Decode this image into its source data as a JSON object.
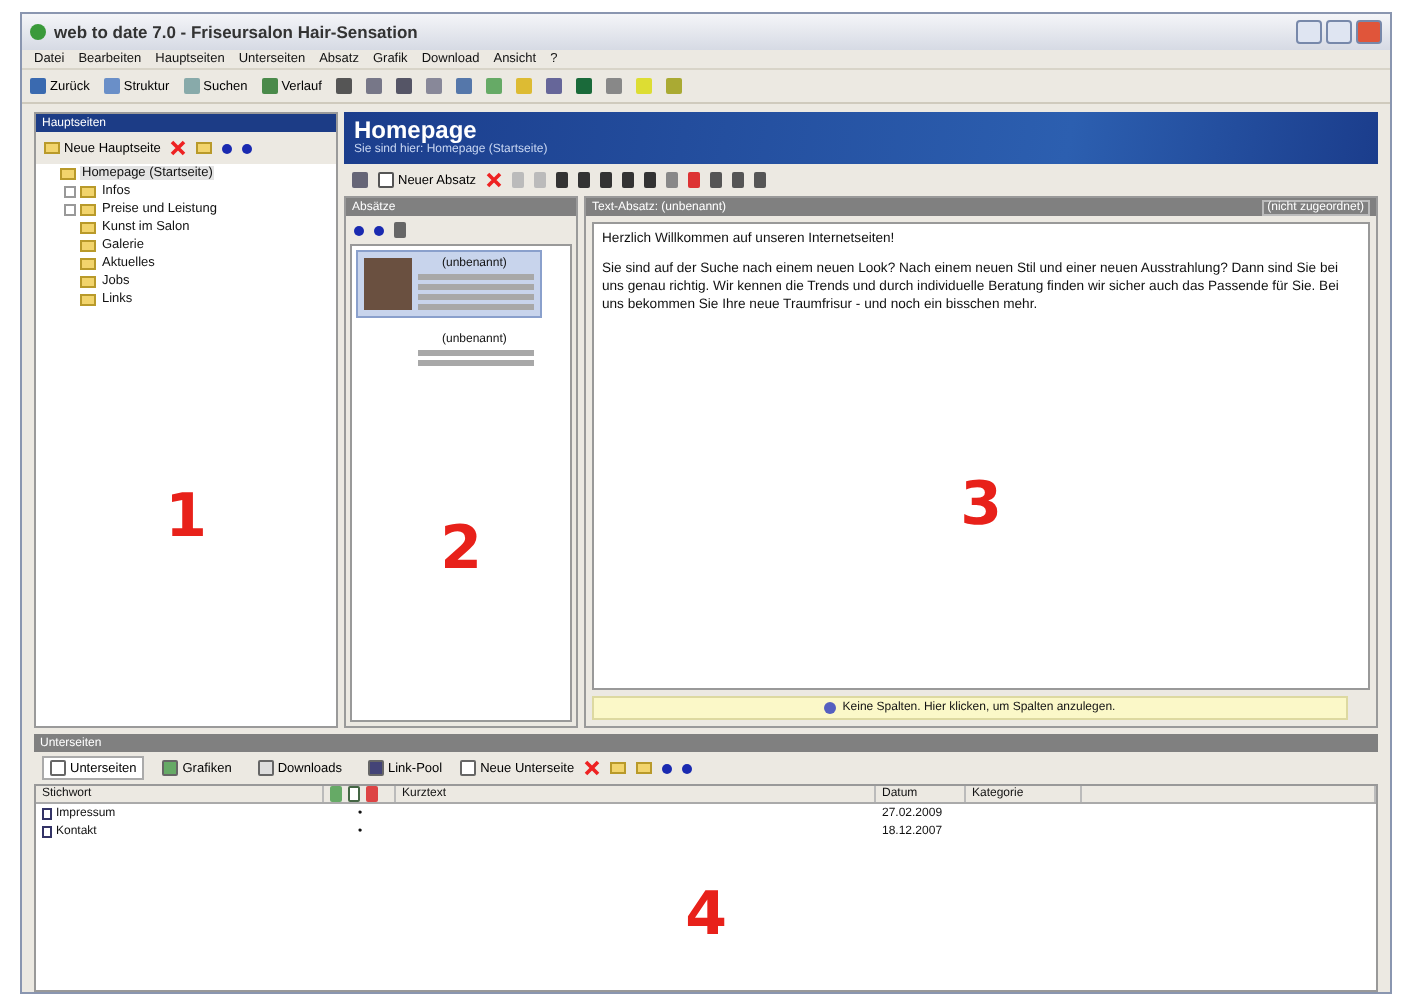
{
  "window": {
    "title": "web to date 7.0 - Friseursalon Hair-Sensation"
  },
  "menu": [
    "Datei",
    "Bearbeiten",
    "Hauptseiten",
    "Unterseiten",
    "Absatz",
    "Grafik",
    "Download",
    "Ansicht",
    "?"
  ],
  "toolbar": [
    {
      "label": "Zurück",
      "kind": "back"
    },
    {
      "label": "Struktur",
      "kind": "structure"
    },
    {
      "label": "Suchen",
      "kind": "search"
    },
    {
      "label": "Verlauf",
      "kind": "history"
    }
  ],
  "main_pages": {
    "header": "Hauptseiten",
    "new_button": "Neue Hauptseite",
    "tree": [
      {
        "label": "Homepage (Startseite)",
        "collapsed": false,
        "selected": true,
        "children": [
          {
            "label": "Infos",
            "collapsed": true,
            "selected": false
          },
          {
            "label": "Preise und Leistung",
            "collapsed": true,
            "selected": false
          },
          {
            "label": "Kunst im Salon",
            "collapsed": false,
            "selected": false
          },
          {
            "label": "Galerie",
            "collapsed": false,
            "selected": false
          },
          {
            "label": "Aktuelles",
            "collapsed": false,
            "selected": false
          },
          {
            "label": "Jobs",
            "collapsed": false,
            "selected": false
          },
          {
            "label": "Links",
            "collapsed": false,
            "selected": false
          }
        ]
      }
    ]
  },
  "page_header": {
    "title": "Homepage",
    "breadcrumb": "Sie sind hier: Homepage (Startseite)"
  },
  "paragraph_toolbar": {
    "new_button": "Neuer Absatz"
  },
  "paragraphs": {
    "header": "Absätze",
    "items": [
      {
        "label": "(unbenannt)",
        "kind": "image",
        "selected": true
      },
      {
        "label": "(unbenannt)",
        "kind": "text",
        "selected": false
      }
    ]
  },
  "text_paragraph": {
    "header": "Text-Absatz: (unbenannt)",
    "alignment": "(nicht zugeordnet)",
    "body": [
      "Herzlich Willkommen auf unseren Internetseiten!",
      "Sie sind auf der Suche nach einem neuen Look? Nach einem neuen Stil und einer neuen Ausstrahlung? Dann sind Sie bei uns genau richtig. Wir kennen die Trends und durch individuelle Beratung finden wir sicher auch das Passende für Sie. Bei uns bekommen Sie Ihre neue Traumfrisur - und noch ein bisschen mehr."
    ],
    "columns_hint": "Keine Spalten. Hier klicken, um Spalten anzulegen."
  },
  "subpages": {
    "header": "Unterseiten",
    "tabs": [
      {
        "label": "Unterseiten",
        "selected": true
      },
      {
        "label": "Grafiken",
        "selected": false
      },
      {
        "label": "Downloads",
        "selected": false
      },
      {
        "label": "Link-Pool",
        "selected": false
      }
    ],
    "new_button": "Neue Unterseite",
    "columns": [
      "Stichwort",
      "Kurztext",
      "Datum",
      "Kategorie"
    ],
    "rows": [
      {
        "stichwort": "Impressum",
        "mark": "•",
        "datum": "27.02.2009"
      },
      {
        "stichwort": "Kontakt",
        "mark": "•",
        "datum": "18.12.2007"
      }
    ]
  },
  "annotations": [
    "1",
    "2",
    "3",
    "4"
  ]
}
